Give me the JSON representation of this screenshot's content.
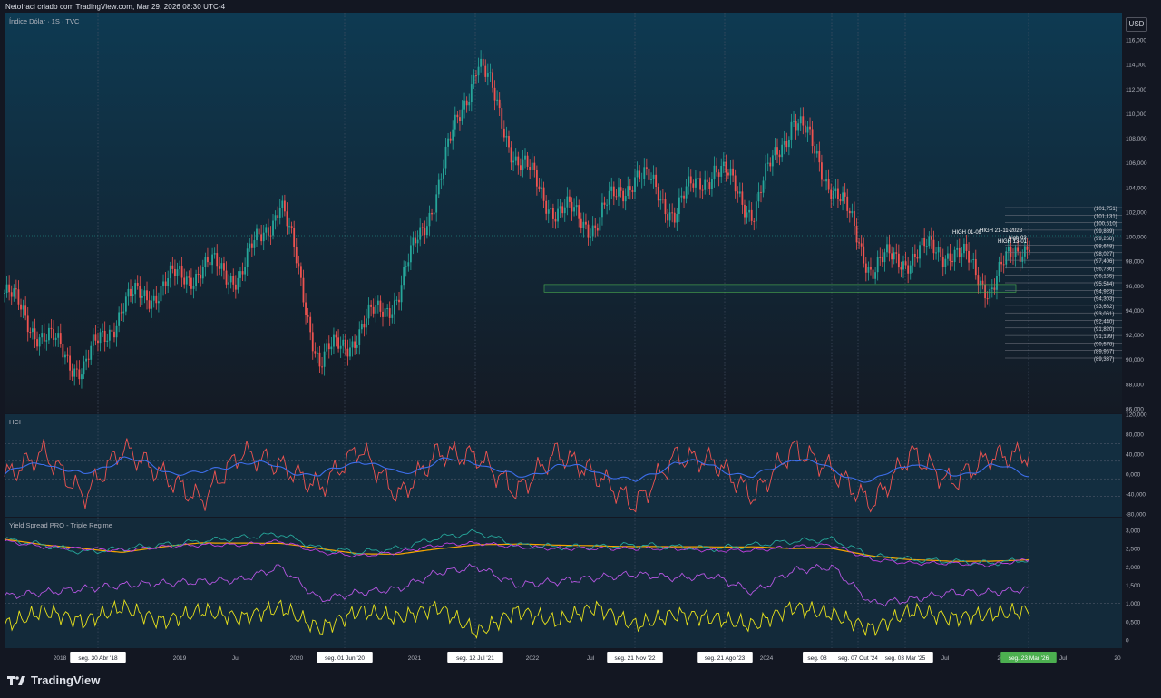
{
  "header": {
    "attribution": "NetoIraci criado com TradingView.com, Mar 29, 2026 08:30 UTC-4"
  },
  "currency_button": "USD",
  "brand": {
    "name": "TradingView"
  },
  "chart_data": [
    {
      "type": "candlestick",
      "title": "Índice Dólar · 1S · TVC",
      "ylim": [
        86,
        116
      ],
      "yticks": [
        "116,000",
        "114,000",
        "112,000",
        "110,000",
        "108,000",
        "106,000",
        "104,000",
        "102,000",
        "100,000",
        "98,000",
        "96,000",
        "94,000",
        "92,000",
        "90,000",
        "88,000",
        "86,000"
      ],
      "x": [
        "2017-07",
        "2018-01",
        "2018-04",
        "2018-07",
        "2019-01",
        "2019-07",
        "2020-01",
        "2020-06",
        "2020-12",
        "2021-07",
        "2022-01",
        "2022-06",
        "2022-09",
        "2022-11",
        "2023-01",
        "2023-07",
        "2023-08",
        "2024-01",
        "2024-06",
        "2024-10",
        "2025-01",
        "2025-03",
        "2025-07",
        "2025-10",
        "2026-01",
        "2026-02",
        "2026-03"
      ],
      "close": [
        95.5,
        92.0,
        89.5,
        94.5,
        96.0,
        97.5,
        97.0,
        102.8,
        90.0,
        92.5,
        95.5,
        104.0,
        114.0,
        106.0,
        102.0,
        101.0,
        105.0,
        102.0,
        105.5,
        102.0,
        109.5,
        104.0,
        97.5,
        98.5,
        99.0,
        96.0,
        100.0
      ],
      "bull_color": "#26a69a",
      "bear_color": "#ef5350",
      "annotations": [
        "HIGH 01-09",
        "HIGH 21-11-2023",
        "high 03",
        "HIGH 13-01"
      ],
      "levels": [
        "(101,751)",
        "(101,131)",
        "(100,510)",
        "(99,889)",
        "(99,268)",
        "(98,648)",
        "(98,027)",
        "(97,406)",
        "(96,786)",
        "(96,165)",
        "(95,544)",
        "(94,923)",
        "(94,303)",
        "(93,682)",
        "(93,061)",
        "(92,440)",
        "(91,820)",
        "(91,199)",
        "(90,578)",
        "(89,957)",
        "(89,337)"
      ]
    },
    {
      "type": "line",
      "title": "HCI",
      "ylim": [
        -80,
        120
      ],
      "yticks": [
        "120,000",
        "80,000",
        "40,000",
        "0,000",
        "-40,000",
        "-80,000"
      ],
      "series": [
        {
          "color": "#ef5350",
          "values": [
            5,
            60,
            -40,
            70,
            10,
            -50,
            60,
            30,
            -20,
            70,
            -40,
            60,
            50,
            -30,
            60,
            10,
            -60,
            50,
            40,
            -40,
            70,
            20,
            -60,
            60,
            -10,
            50,
            55
          ]
        },
        {
          "color": "#3d6eea",
          "values": [
            10,
            40,
            5,
            50,
            20,
            10,
            40,
            25,
            5,
            45,
            10,
            40,
            40,
            0,
            30,
            20,
            -10,
            40,
            30,
            0,
            50,
            20,
            -10,
            40,
            5,
            30,
            10
          ]
        }
      ]
    },
    {
      "type": "line",
      "title": "Yield Spread PRO - Triple Regime",
      "ylim": [
        0,
        3.2
      ],
      "yticks": [
        "3,000",
        "2,500",
        "2,000",
        "1,500",
        "1,000",
        "0,500",
        "0"
      ],
      "series": [
        {
          "color": "#f7a600",
          "values": [
            2.75,
            2.6,
            2.5,
            2.4,
            2.55,
            2.65,
            2.65,
            2.65,
            2.5,
            2.35,
            2.35,
            2.5,
            2.6,
            2.62,
            2.6,
            2.58,
            2.55,
            2.55,
            2.55,
            2.55,
            2.5,
            2.5,
            2.3,
            2.2,
            2.15,
            2.15,
            2.2
          ]
        },
        {
          "color": "#26a69a",
          "values": [
            2.75,
            2.6,
            2.4,
            2.5,
            2.6,
            2.7,
            2.8,
            2.9,
            2.5,
            2.4,
            2.5,
            2.8,
            2.95,
            2.6,
            2.55,
            2.55,
            2.6,
            2.55,
            2.5,
            2.6,
            2.7,
            2.75,
            2.3,
            2.2,
            2.15,
            2.1,
            2.2
          ]
        },
        {
          "color": "#c040e0",
          "values": [
            2.7,
            2.55,
            2.5,
            2.45,
            2.55,
            2.6,
            2.6,
            2.7,
            2.4,
            2.3,
            2.4,
            2.6,
            2.65,
            2.55,
            2.5,
            2.5,
            2.5,
            2.5,
            2.45,
            2.45,
            2.55,
            2.6,
            2.2,
            2.1,
            2.1,
            2.05,
            2.2
          ]
        },
        {
          "color": "#b455e0",
          "values": [
            1.2,
            1.3,
            1.4,
            1.5,
            1.55,
            1.6,
            1.65,
            2.0,
            1.1,
            1.3,
            1.4,
            1.85,
            2.0,
            1.5,
            1.6,
            1.7,
            1.8,
            1.7,
            1.75,
            1.3,
            1.9,
            2.0,
            1.0,
            1.1,
            1.3,
            1.3,
            1.4
          ]
        },
        {
          "color": "#e8e21b",
          "values": [
            0.4,
            0.8,
            0.5,
            0.9,
            0.5,
            0.8,
            0.6,
            0.9,
            0.3,
            0.8,
            0.6,
            0.9,
            0.2,
            0.8,
            0.5,
            0.9,
            0.4,
            0.7,
            0.6,
            0.4,
            0.9,
            0.7,
            0.3,
            0.8,
            0.6,
            0.7,
            0.8
          ]
        }
      ]
    },
    {
      "type": "axis",
      "xticks": [
        "2018",
        "seg. 30 Abr '18",
        "2019",
        "Jul",
        "2020",
        "seg. 01 Jun '20",
        "2021",
        "seg. 12 Jul '21",
        "2022",
        "Jul",
        "seg. 21 Nov '22",
        "seg. 21 Ago '23",
        "2024",
        "seg. 08",
        "seg. 07 Out '24",
        "seg. 03 Mar '25",
        "Jul",
        "20",
        "seg. 23 Mar '26",
        "Jul",
        "20"
      ]
    }
  ]
}
